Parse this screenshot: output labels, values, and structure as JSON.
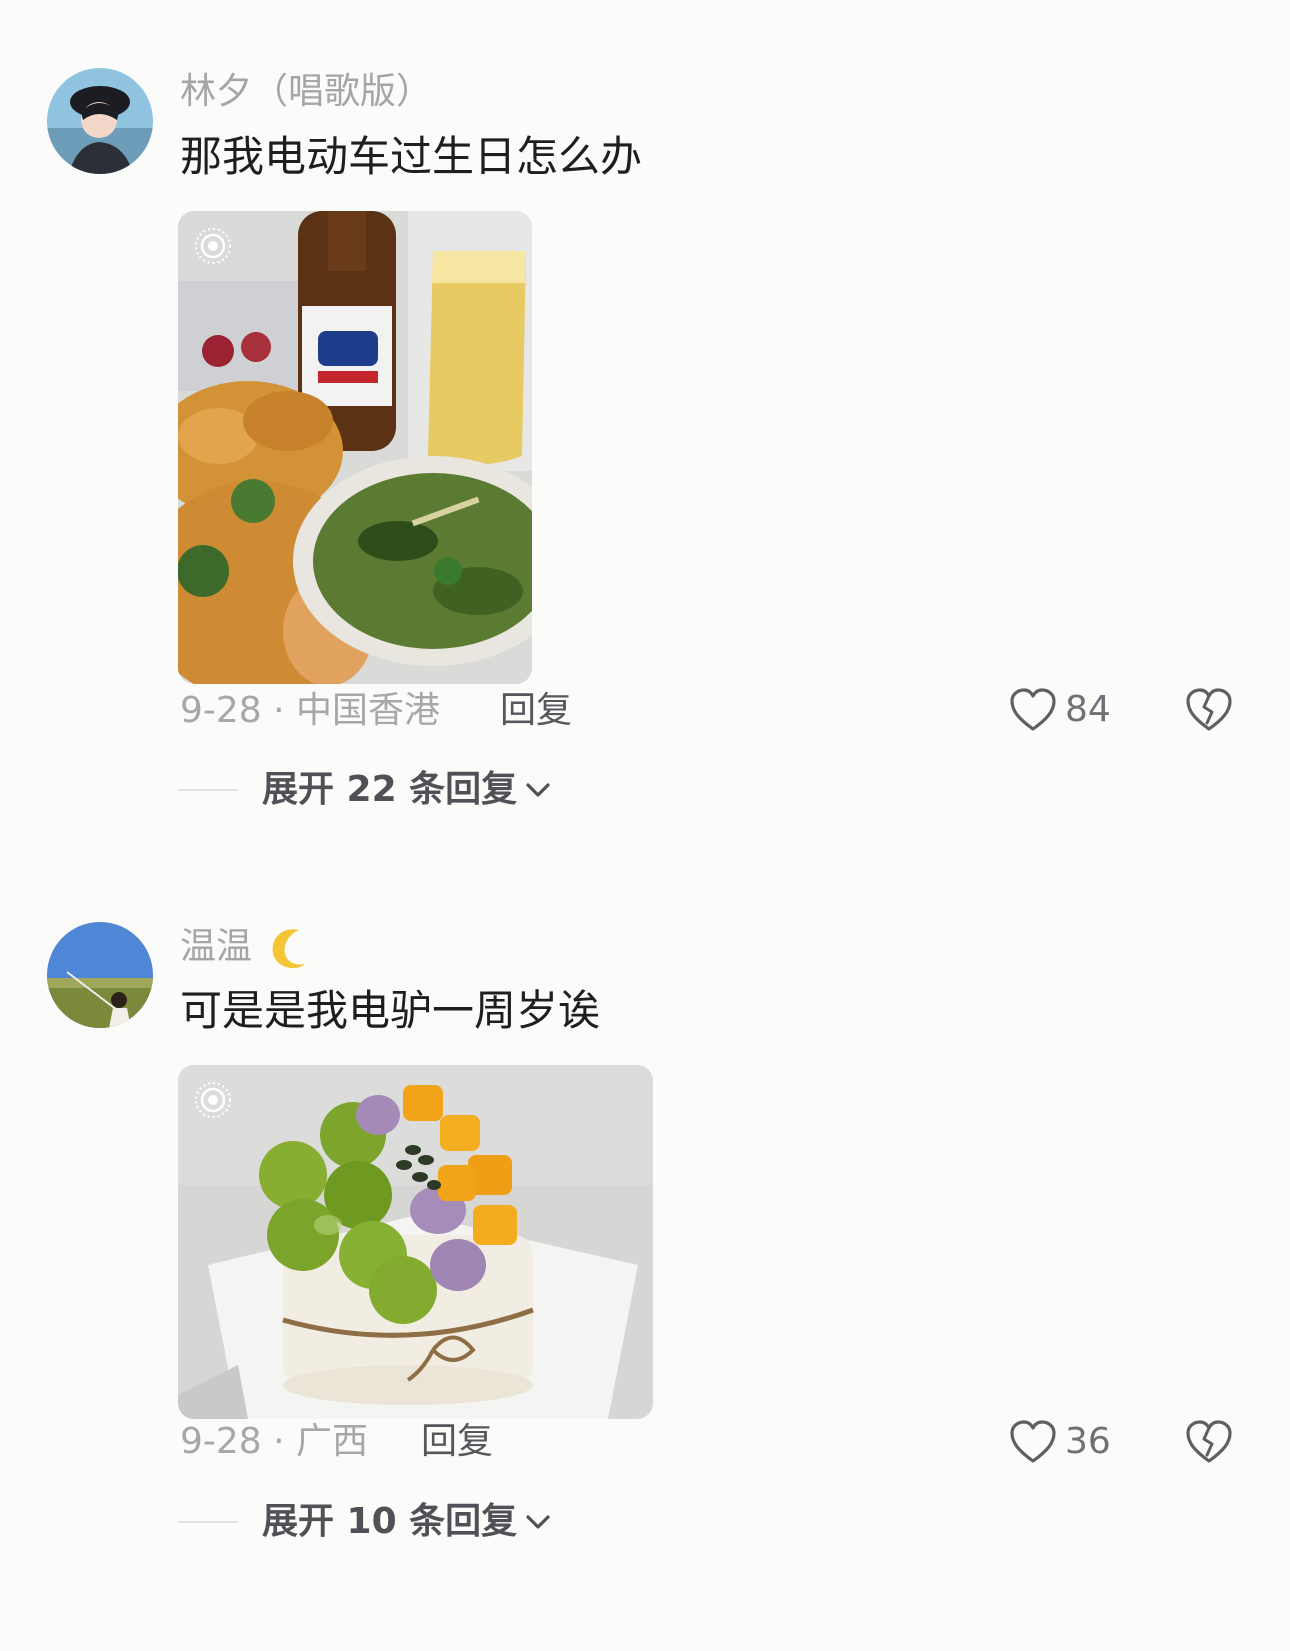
{
  "comments": [
    {
      "username": "林夕（唱歌版）",
      "text": "那我电动车过生日怎么办",
      "image": "photo-beer-and-food",
      "date_location": "9-28 · 中国香港",
      "reply_label": "回复",
      "likes": "84",
      "expand_label": "展开 22 条回复"
    },
    {
      "username": "温温",
      "username_emoji": "crescent-moon-icon",
      "text": "可是是我电驴一周岁诶",
      "image": "photo-fruit-cake",
      "date_location": "9-28 · 广西",
      "reply_label": "回复",
      "likes": "36",
      "expand_label": "展开 10 条回复"
    }
  ],
  "icons": {
    "like": "heart-outline-icon",
    "dislike": "broken-heart-icon",
    "expand": "chevron-down-icon",
    "live_photo": "live-photo-icon"
  },
  "colors": {
    "background": "#fbfcfa",
    "username": "#a4a5a8",
    "text": "#1d1e22",
    "meta": "#a6a7aa"
  }
}
